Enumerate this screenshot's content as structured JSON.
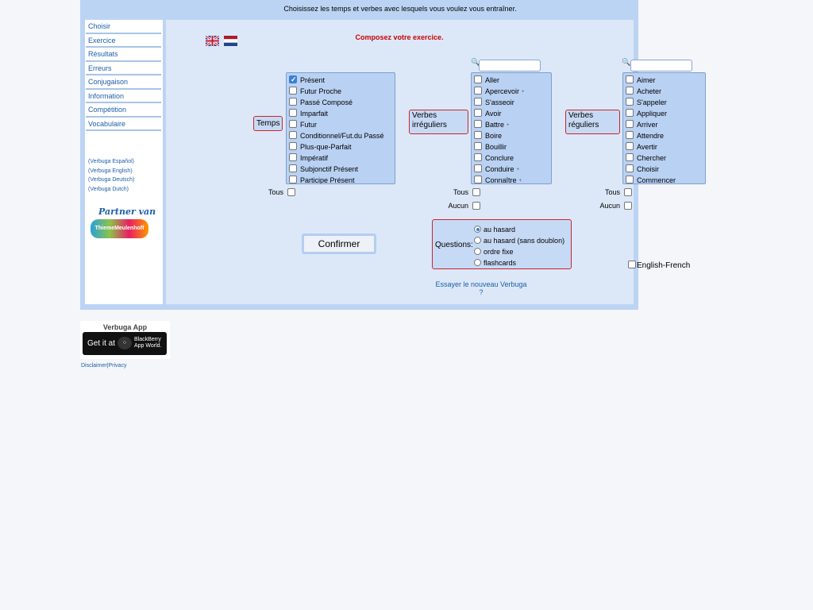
{
  "header": {
    "instruction": "Choisissez les temps et verbes avec lesquels vous voulez vous entraîner."
  },
  "sidebar": {
    "items": [
      {
        "label": "Choisir"
      },
      {
        "label": "Exercice"
      },
      {
        "label": "Résultats"
      },
      {
        "label": "Erreurs"
      },
      {
        "label": "Conjugaison"
      },
      {
        "label": "Information"
      },
      {
        "label": "Compétition"
      },
      {
        "label": "Vocabulaire"
      }
    ],
    "lang_links": [
      {
        "label": "(Verbuga Español)"
      },
      {
        "label": "(Verbuga English)"
      },
      {
        "label": "(Verbuga Deutsch)"
      },
      {
        "label": "(Verbuga Dutch)"
      }
    ],
    "partner": {
      "line1": "Partner van",
      "line2": "ThiemeMeulenhoff"
    }
  },
  "main": {
    "title": "Composez votre exercice.",
    "flags": [
      "uk-flag",
      "dutch-flag"
    ],
    "tenses": {
      "label": "Temps",
      "items": [
        {
          "label": "Présent",
          "checked": true
        },
        {
          "label": "Futur Proche",
          "checked": false
        },
        {
          "label": "Passé Composé",
          "checked": false
        },
        {
          "label": "Imparfait",
          "checked": false
        },
        {
          "label": "Futur",
          "checked": false
        },
        {
          "label": "Conditionnel/Fut.du Passé",
          "checked": false
        },
        {
          "label": "Plus-que-Parfait",
          "checked": false
        },
        {
          "label": "Impératif",
          "checked": false
        },
        {
          "label": "Subjonctif Présent",
          "checked": false
        },
        {
          "label": "Participe Présent",
          "checked": false
        }
      ]
    },
    "irregular": {
      "label": "Verbes irréguliers",
      "items": [
        {
          "label": "Aller",
          "plus": false
        },
        {
          "label": "Apercevoir",
          "plus": true
        },
        {
          "label": "S'asseoir",
          "plus": false
        },
        {
          "label": "Avoir",
          "plus": false
        },
        {
          "label": "Battre",
          "plus": true
        },
        {
          "label": "Boire",
          "plus": false
        },
        {
          "label": "Bouillir",
          "plus": false
        },
        {
          "label": "Conclure",
          "plus": false
        },
        {
          "label": "Conduire",
          "plus": true
        },
        {
          "label": "Connaître",
          "plus": true
        }
      ]
    },
    "regular": {
      "label": "Verbes réguliers",
      "items": [
        {
          "label": "Aimer"
        },
        {
          "label": "Acheter"
        },
        {
          "label": "S'appeler"
        },
        {
          "label": "Appliquer"
        },
        {
          "label": "Arriver"
        },
        {
          "label": "Attendre"
        },
        {
          "label": "Avertir"
        },
        {
          "label": "Chercher"
        },
        {
          "label": "Choisir"
        },
        {
          "label": "Commencer"
        }
      ]
    },
    "tous_label": "Tous",
    "aucun_label": "Aucun",
    "plus_glyph": "+",
    "confirm_label": "Confirmer",
    "questions": {
      "label": "Questions:",
      "options": [
        {
          "label": "au hasard",
          "selected": true
        },
        {
          "label": "au hasard (sans doublon)",
          "selected": false
        },
        {
          "label": "ordre fixe",
          "selected": false
        },
        {
          "label": "flashcards",
          "selected": false
        }
      ]
    },
    "english_french_label": "English-French",
    "try_new_label": "Essayer le nouveau Verbuga ?"
  },
  "app_badge": {
    "title": "Verbuga App",
    "get_it": "Get it at",
    "store_line1": "BlackBerry",
    "store_line2": "App World."
  },
  "footer": {
    "disclaimer": "Disclaimer",
    "separator": "|",
    "privacy": "Privacy"
  },
  "colors": {
    "frame": "#bcd4f4",
    "panel": "#dce8f8",
    "link": "#1c5fa8",
    "accent_red": "#cc0000"
  }
}
